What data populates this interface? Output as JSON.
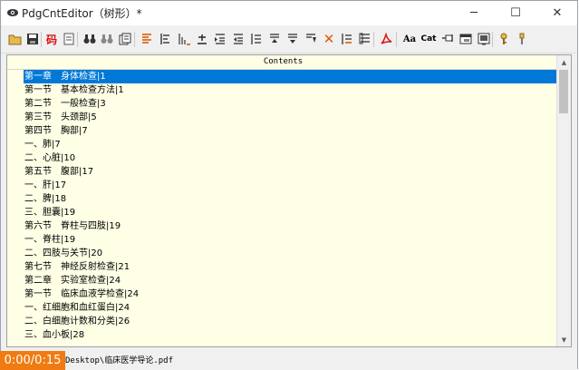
{
  "window": {
    "title": "PdgCntEditor（树形）*",
    "minimize_glyph": "─",
    "maximize_glyph": "☐",
    "close_glyph": "✕"
  },
  "toolbar": {
    "icons": [
      "open-folder-icon",
      "save-icon",
      "code-icon",
      "page-icon",
      "binoculars-icon",
      "find-replace-icon",
      "document-icon",
      "align-text-icon",
      "list-icon",
      "list-numbered-icon",
      "plus-minus-icon",
      "indent-left-icon",
      "outdent-icon",
      "indent-bar-icon",
      "move-up-icon",
      "move-down-icon",
      "arrow-down-icon",
      "delete-icon",
      "expand-icon",
      "collapse-icon",
      "pdf-icon",
      "font-case-icon",
      "category-icon",
      "push-pin-icon",
      "window-icon",
      "screen-icon",
      "key-icon",
      "tool-icon"
    ],
    "labels": {
      "code": "码",
      "font_case": "Aa",
      "category": "Cat",
      "delete": "✕"
    }
  },
  "content": {
    "header": "Contents",
    "rows": [
      "第一章　身体检查|1",
      "第一节　基本检查方法|1",
      "第二节　一般检查|3",
      "第三节　头颈部|5",
      "第四节　胸部|7",
      "一、肺|7",
      "二、心脏|10",
      "第五节　腹部|17",
      "一、肝|17",
      "二、脾|18",
      "三、胆囊|19",
      "第六节　脊柱与四肢|19",
      "一、脊柱|19",
      "二、四肢与关节|20",
      "第七节　神经反射检查|21",
      "第二章　实验室检查|24",
      "第一节　临床血液学检查|24",
      "一、红细胞和血红蛋白|24",
      "二、白细胞计数和分类|26",
      "三、血小板|28"
    ],
    "selected_index": 0
  },
  "status": {
    "path": "Desktop\\临床医学导论.pdf"
  },
  "overlay": {
    "timer": "0:00/0:15"
  },
  "colors": {
    "selection": "#0078d7",
    "content_bg": "#ffffe6",
    "timer_bg": "#f07b12"
  }
}
